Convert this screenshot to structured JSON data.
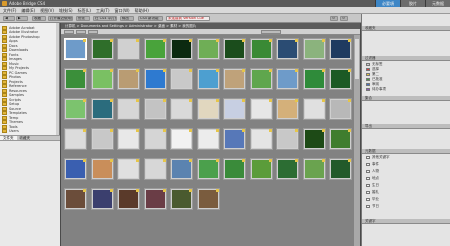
{
  "window": {
    "title": "Adobe Bridge CS4",
    "mode_tabs": [
      "必要項",
      "胶片",
      "元数据"
    ]
  },
  "menu": [
    "文件(F)",
    "编辑(E)",
    "视图(V)",
    "堆栈(S)",
    "标签(L)",
    "工具(T)",
    "窗口(W)",
    "帮助(H)"
  ],
  "toolbar": {
    "buttons": [
      "收藏",
      "打开最近使用的文件",
      "优化",
      "在 CS4 中打开",
      "输出",
      "CS4 新功能"
    ],
    "warning": "未连接到 Version Cue"
  },
  "path": {
    "text": "计算机 > Documents and Settings > Administrator > 桌面 > 素材 > 我的图片"
  },
  "folders": [
    "Adobe Acrobat",
    "Adobe Illustrator",
    "Adobe Photoshop",
    "Apps",
    "Docs",
    "Downloads",
    "Fonts",
    "Images",
    "Music",
    "My Projects",
    "PC Games",
    "Photos",
    "Projects",
    "Reference",
    "Resources",
    "Samples",
    "Scripts",
    "Setup",
    "Source",
    "Templates",
    "Temp",
    "Themes",
    "Tools",
    "Users"
  ],
  "left_tabs": [
    "文件夹",
    "收藏夹"
  ],
  "thumbnails": [
    {
      "cap": "",
      "color": "#6e9bc9",
      "sel": true
    },
    {
      "cap": "",
      "color": "#2f6e2a"
    },
    {
      "cap": "",
      "color": "#d0d0d0"
    },
    {
      "cap": "",
      "color": "#49a33b"
    },
    {
      "cap": "",
      "color": "#0c2a10"
    },
    {
      "cap": "",
      "color": "#6fae56"
    },
    {
      "cap": "",
      "color": "#1b4d1c"
    },
    {
      "cap": "",
      "color": "#3a8a35"
    },
    {
      "cap": "",
      "color": "#2b4c73"
    },
    {
      "cap": "",
      "color": "#8bb37d"
    },
    {
      "cap": "",
      "color": "#1f3b60"
    },
    {
      "cap": "",
      "color": "#3b8f3a"
    },
    {
      "cap": "",
      "color": "#7ac063"
    },
    {
      "cap": "",
      "color": "#b99c73"
    },
    {
      "cap": "",
      "color": "#2e7ad0"
    },
    {
      "cap": "",
      "color": "#c9c9c9"
    },
    {
      "cap": "",
      "color": "#4d9fd0"
    },
    {
      "cap": "",
      "color": "#bfa27a"
    },
    {
      "cap": "",
      "color": "#5fa64d"
    },
    {
      "cap": "",
      "color": "#6e9bc9"
    },
    {
      "cap": "",
      "color": "#2f8b3a"
    },
    {
      "cap": "",
      "color": "#1c5a25"
    },
    {
      "cap": "",
      "color": "#7cc36e"
    },
    {
      "cap": "",
      "color": "#2b6c7d"
    },
    {
      "cap": "",
      "color": "#d6d6d6"
    },
    {
      "cap": "",
      "color": "#c3c3c3"
    },
    {
      "cap": "",
      "color": "#d9d9d9"
    },
    {
      "cap": "",
      "color": "#e1d7bf"
    },
    {
      "cap": "",
      "color": "#c7cfe2"
    },
    {
      "cap": "",
      "color": "#e6e6e6"
    },
    {
      "cap": "",
      "color": "#d4b07a"
    },
    {
      "cap": "",
      "color": "#e0e0e0"
    },
    {
      "cap": "",
      "color": "#b8b8b8"
    },
    {
      "cap": "",
      "color": "#dcdcdc"
    },
    {
      "cap": "",
      "color": "#c8c8c8"
    },
    {
      "cap": "",
      "color": "#e8e8e8"
    },
    {
      "cap": "",
      "color": "#d5d5d5"
    },
    {
      "cap": "",
      "color": "#f2f2f2"
    },
    {
      "cap": "",
      "color": "#ececec"
    },
    {
      "cap": "",
      "color": "#5778b8"
    },
    {
      "cap": "",
      "color": "#e4e4e4"
    },
    {
      "cap": "",
      "color": "#c8c8c8"
    },
    {
      "cap": "",
      "color": "#1d4a16"
    },
    {
      "cap": "",
      "color": "#3f7d2e"
    },
    {
      "cap": "",
      "color": "#3a5fb0"
    },
    {
      "cap": "",
      "color": "#c98e5a"
    },
    {
      "cap": "",
      "color": "#e0e0e0"
    },
    {
      "cap": "",
      "color": "#d7d7d7"
    },
    {
      "cap": "",
      "color": "#5b83b0"
    },
    {
      "cap": "",
      "color": "#4ba04c"
    },
    {
      "cap": "",
      "color": "#3a8b3a"
    },
    {
      "cap": "",
      "color": "#5b9c3a"
    },
    {
      "cap": "",
      "color": "#2c6d33"
    },
    {
      "cap": "",
      "color": "#6aa34f"
    },
    {
      "cap": "",
      "color": "#225a2a"
    },
    {
      "cap": "",
      "color": "#6b4d3a"
    },
    {
      "cap": "",
      "color": "#3b3f6e"
    },
    {
      "cap": "",
      "color": "#5a3a2a"
    },
    {
      "cap": "",
      "color": "#6a3d46"
    },
    {
      "cap": "",
      "color": "#4a5a2f"
    },
    {
      "cap": "",
      "color": "#7a5c3e"
    }
  ],
  "right_panel": {
    "sections": [
      "收藏夹",
      "过滤器",
      "集合",
      "导出",
      "元数据",
      "关键字"
    ],
    "filters": [
      {
        "label": "无标签",
        "n": "",
        "color": "#d0d0d0"
      },
      {
        "label": "选择",
        "n": "",
        "color": "#d84040"
      },
      {
        "label": "第二",
        "n": "",
        "color": "#e8c840"
      },
      {
        "label": "已批准",
        "n": "",
        "color": "#40a040"
      },
      {
        "label": "审阅",
        "n": "",
        "color": "#4070d0"
      },
      {
        "label": "待办事项",
        "n": "",
        "color": "#9050c0"
      }
    ],
    "keywords": [
      "其他关键字",
      "事件",
      "人物",
      "地点",
      "生日",
      "婚礼",
      "毕业",
      "节日"
    ]
  }
}
